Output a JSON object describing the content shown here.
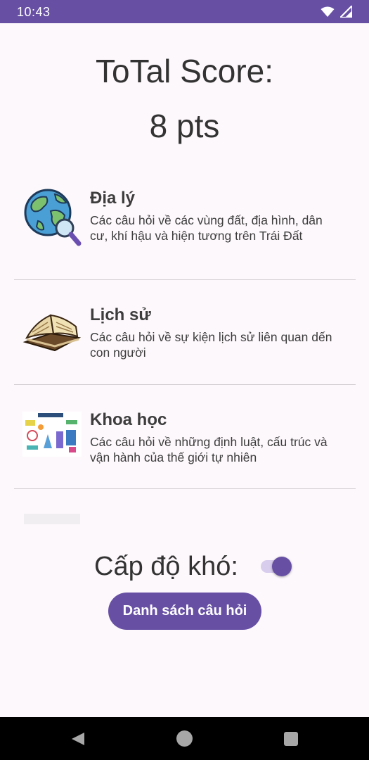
{
  "status_bar": {
    "time": "10:43",
    "background": "#6750a4"
  },
  "score": {
    "title": "ToTal Score:",
    "value": "8 pts"
  },
  "topics": [
    {
      "icon": "globe-magnifier-icon",
      "name": "Địa lý",
      "description": "Các câu hỏi về các vùng đất, địa hình, dân cư, khí hậu và hiện tương trên Trái Đất"
    },
    {
      "icon": "open-book-icon",
      "name": "Lịch sử",
      "description": "Các câu hỏi về sự kiện lịch sử liên quan dến con người"
    },
    {
      "icon": "science-icon",
      "name": "Khoa học",
      "description": "Các câu hỏi về những định luật, cấu trúc và vận hành của thế giới tự nhiên"
    }
  ],
  "difficulty": {
    "label": "Cấp độ khó:",
    "toggle_on": true
  },
  "list_button": {
    "label": "Danh sách câu hỏi"
  },
  "colors": {
    "accent": "#6750a4",
    "background": "#fdf8fc",
    "toggle_track": "#d9cdee"
  }
}
